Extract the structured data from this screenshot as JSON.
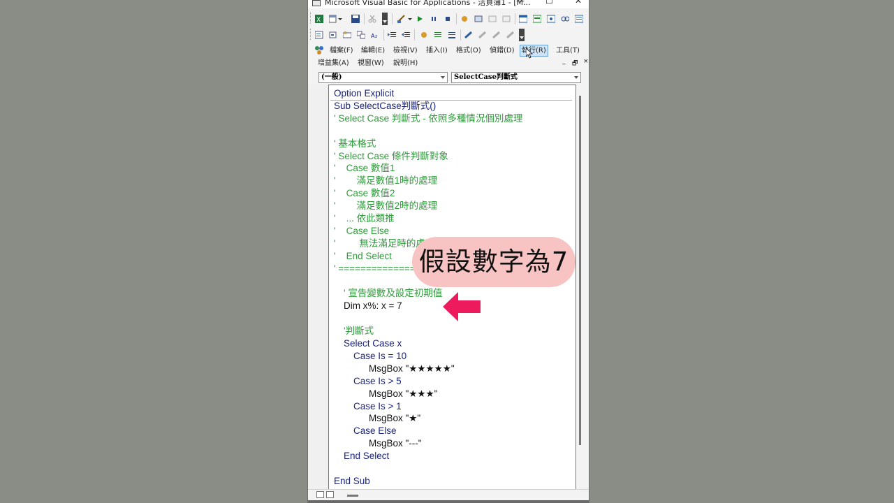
{
  "window": {
    "title": "Microsoft Visual Basic for Applications - 活頁簿1 - [M...",
    "minimize_icon": "minimize-icon",
    "maximize_icon": "maximize-icon",
    "close_icon": "close-icon",
    "min_glyph": "—",
    "max_glyph": "☐",
    "close_glyph": "✕"
  },
  "menubar": {
    "items": [
      {
        "label": "檔案(F)"
      },
      {
        "label": "編輯(E)"
      },
      {
        "label": "檢視(V)"
      },
      {
        "label": "插入(I)"
      },
      {
        "label": "格式(O)"
      },
      {
        "label": "偵錯(D)"
      },
      {
        "label": "執行(R)",
        "active": true
      },
      {
        "label": "工具(T)"
      },
      {
        "label": "增益集(A)"
      },
      {
        "label": "視窗(W)"
      },
      {
        "label": "說明(H)"
      }
    ],
    "mdi_minimize": "_",
    "mdi_restore": "🗗",
    "mdi_close": "×"
  },
  "combos": {
    "object": "(一般)",
    "procedure": "SelectCase判斷式"
  },
  "code": {
    "lines": [
      {
        "t": "Option Explicit",
        "c": "kw",
        "i": 0
      },
      {
        "t": "Sub SelectCase判斷式()",
        "c": "kw",
        "i": 0
      },
      {
        "t": "' Select Case 判斷式 - 依照多種情況個別處理",
        "c": "cm",
        "i": 0
      },
      {
        "t": "",
        "c": "tx",
        "i": 0
      },
      {
        "t": "' 基本格式",
        "c": "cm",
        "i": 0
      },
      {
        "t": "' Select Case 條件判斷對象",
        "c": "cm",
        "i": 0
      },
      {
        "t": "'    Case 數值1",
        "c": "cm",
        "i": 0
      },
      {
        "t": "'        滿足數值1時的處理",
        "c": "cm",
        "i": 0
      },
      {
        "t": "'    Case 數值2",
        "c": "cm",
        "i": 0
      },
      {
        "t": "'        滿足數值2時的處理",
        "c": "cm",
        "i": 0
      },
      {
        "t": "'    ... 依此類推",
        "c": "cm",
        "i": 0
      },
      {
        "t": "'    Case Else",
        "c": "cm",
        "i": 0
      },
      {
        "t": "'         無法滿足時的處理",
        "c": "cm",
        "i": 0
      },
      {
        "t": "'    End Select",
        "c": "cm",
        "i": 0
      },
      {
        "t": "' ======================================",
        "c": "cm",
        "i": 0
      },
      {
        "t": "",
        "c": "tx",
        "i": 0
      },
      {
        "t": "' 宣告變數及設定初期值",
        "c": "cm",
        "i": 1
      },
      {
        "t": "Dim x%: x = 7",
        "c": "tx",
        "i": 1
      },
      {
        "t": "",
        "c": "tx",
        "i": 0
      },
      {
        "t": "'判斷式",
        "c": "cm",
        "i": 1
      },
      {
        "t": "Select Case x",
        "c": "kw",
        "i": 1
      },
      {
        "t": "Case Is = 10",
        "c": "kw",
        "i": 2
      },
      {
        "t": "MsgBox \"★★★★★\"",
        "c": "tx",
        "i": 3
      },
      {
        "t": "Case Is > 5",
        "c": "kw",
        "i": 2
      },
      {
        "t": "MsgBox \"★★★\"",
        "c": "tx",
        "i": 3
      },
      {
        "t": "Case Is > 1",
        "c": "kw",
        "i": 2
      },
      {
        "t": "MsgBox \"★\"",
        "c": "tx",
        "i": 3
      },
      {
        "t": "Case Else",
        "c": "kw",
        "i": 2
      },
      {
        "t": "MsgBox \"---\"",
        "c": "tx",
        "i": 3
      },
      {
        "t": "End Select",
        "c": "kw",
        "i": 1
      },
      {
        "t": "",
        "c": "tx",
        "i": 0
      },
      {
        "t": "End Sub",
        "c": "kw",
        "i": 0
      }
    ]
  },
  "overlay": {
    "caption": "假設數字為7",
    "caption_bg": "#f7c3c3",
    "arrow_color": "#ee1a5e",
    "arrow_icon": "left-arrow-icon"
  },
  "colors": {
    "keyword": "#1a237e",
    "comment": "#2e9b3a",
    "text": "#111111"
  }
}
